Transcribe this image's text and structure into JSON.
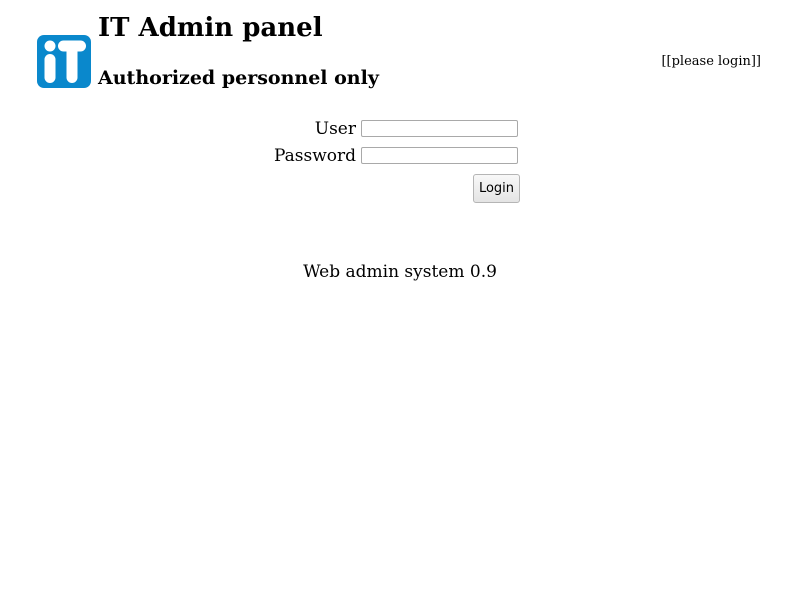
{
  "header": {
    "logo_icon": "it-logo-icon",
    "logo_text": "iT",
    "logo_color": "#0a88cc",
    "title": "IT Admin panel",
    "subtitle": "Authorized personnel only",
    "status": "[[please login]]"
  },
  "login_form": {
    "user_label": "User",
    "user_value": "",
    "password_label": "Password",
    "password_value": "",
    "submit_label": "Login"
  },
  "footer": {
    "text": "Web admin system 0.9"
  }
}
